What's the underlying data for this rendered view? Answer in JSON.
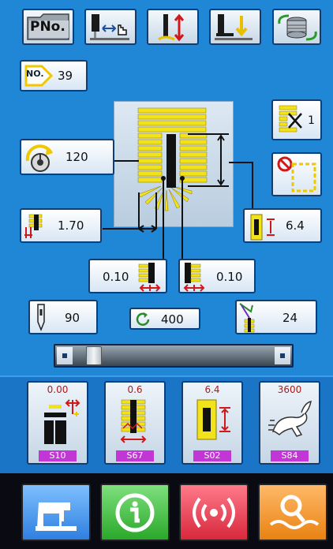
{
  "toolbar": {
    "pno_label": "PNo."
  },
  "pattern": {
    "no_label": "NO.",
    "no_value": "39"
  },
  "params": {
    "times_label": "1",
    "speed_value": "120",
    "stitch_width_value": "1.70",
    "bartack_length_value": "6.4",
    "offset_left_value": "0.10",
    "offset_right_value": "0.10",
    "needle_value": "90",
    "counter_value": "400",
    "stitch_count_value": "24"
  },
  "memory": [
    {
      "value": "0.00",
      "label": "S10"
    },
    {
      "value": "0.6",
      "label": "S67"
    },
    {
      "value": "6.4",
      "label": "S02"
    },
    {
      "value": "3600",
      "label": "S84"
    }
  ],
  "slider_fraction": 0.07,
  "colors": {
    "screen_blue": "#1f87d6",
    "yellow": "#f2e21c",
    "memory_tag": "#c236d6",
    "green_button": "#33b533",
    "red_button": "#e23b4d",
    "orange_button": "#f0921c",
    "blue_button": "#3b8fe8"
  },
  "icons": [
    "folder-icon",
    "needle-move-icon",
    "presser-up-down-icon",
    "presser-foot-icon",
    "thread-wind-icon",
    "diamond-no-icon",
    "times-icon",
    "speed-knob-icon",
    "no-stop-icon",
    "stitch-width-icon",
    "bartack-length-icon",
    "left-offset-icon",
    "right-offset-icon",
    "needle-icon",
    "counter-icon",
    "stitch-count-icon",
    "sewing-machine-icon",
    "info-icon",
    "alarm-icon",
    "search-icon"
  ]
}
